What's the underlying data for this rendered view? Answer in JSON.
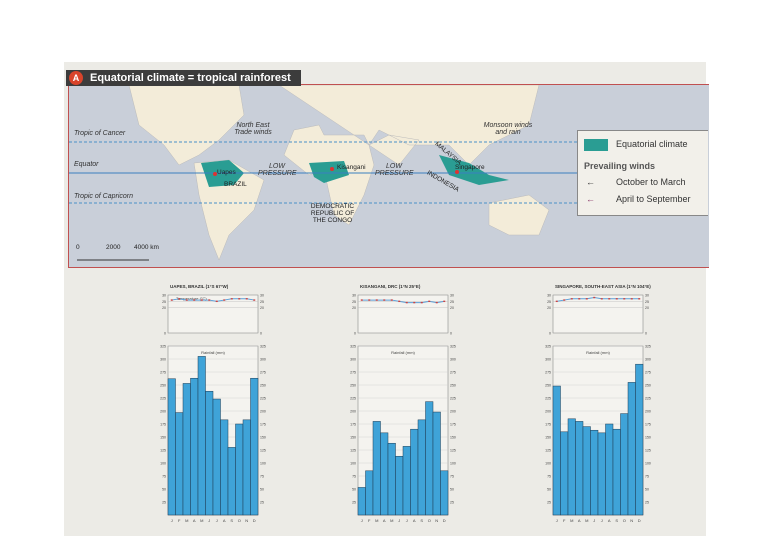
{
  "map": {
    "badge": "A",
    "title": "Equatorial climate = tropical rainforest",
    "lines": {
      "cancer": "Tropic of Cancer",
      "equator": "Equator",
      "capricorn": "Tropic of Capricorn"
    },
    "labels": {
      "ne_trade": "North East Trade winds",
      "monsoon": "Monsoon winds and rain",
      "low1": "LOW PRESSURE",
      "low2": "LOW PRESSURE",
      "uapes": "Uapes",
      "brazil": "BRAZIL",
      "kisangani": "Kisangani",
      "drc": "DEMOCRATIC REPUBLIC OF THE CONGO",
      "malaysia": "MALAYSIA",
      "singapore": "Singapore",
      "indonesia": "INDONESIA"
    },
    "scale": [
      "0",
      "2000",
      "4000 km"
    ],
    "legend": {
      "equatorial": "Equatorial climate",
      "winds_title": "Prevailing winds",
      "oct_mar": "October to March",
      "apr_sep": "April to September"
    },
    "colors": {
      "equatorial": "#2a9d93",
      "oct_mar": "#333333",
      "apr_sep": "#8a3a6a",
      "ocean": "#c9cfd9",
      "land": "#f3ecd9"
    }
  },
  "chart_data": [
    {
      "type": "bar",
      "title": "UAPES, BRAZIL (1°S 67°W)",
      "categories": [
        "J",
        "F",
        "M",
        "A",
        "M",
        "J",
        "J",
        "A",
        "S",
        "O",
        "N",
        "D"
      ],
      "temp_label": "Temperature (°C)",
      "temp": [
        26,
        27,
        26,
        26,
        26,
        26,
        25,
        26,
        27,
        27,
        27,
        26
      ],
      "temp_ylim": [
        0,
        30
      ],
      "temp_ticks": [
        "30",
        "25",
        "20",
        "0"
      ],
      "rain_label": "Rainfall (mm)",
      "rain": [
        262,
        197,
        253,
        263,
        305,
        238,
        223,
        183,
        130,
        175,
        183,
        263
      ],
      "rain_ylim": [
        0,
        325
      ],
      "rain_ticks": [
        "325",
        "300",
        "275",
        "250",
        "225",
        "200",
        "175",
        "150",
        "125",
        "100",
        "75",
        "50",
        "25"
      ]
    },
    {
      "type": "bar",
      "title": "KISANGANI, DRC (1°N 25°E)",
      "categories": [
        "J",
        "F",
        "M",
        "A",
        "M",
        "J",
        "J",
        "A",
        "S",
        "O",
        "N",
        "D"
      ],
      "temp_label": "",
      "temp": [
        26,
        26,
        26,
        26,
        26,
        25,
        24,
        24,
        24,
        25,
        24,
        25
      ],
      "temp_ylim": [
        0,
        30
      ],
      "temp_ticks": [
        "30",
        "25",
        "20",
        "0"
      ],
      "rain_label": "Rainfall (mm)",
      "rain": [
        53,
        85,
        180,
        158,
        138,
        113,
        132,
        165,
        183,
        218,
        198,
        85
      ],
      "rain_ylim": [
        0,
        325
      ],
      "rain_ticks": [
        "325",
        "300",
        "275",
        "250",
        "225",
        "200",
        "175",
        "150",
        "125",
        "100",
        "75",
        "50",
        "25"
      ]
    },
    {
      "type": "bar",
      "title": "SINGAPORE, SOUTH-EAST ASIA (1°N 104°E)",
      "categories": [
        "J",
        "F",
        "M",
        "A",
        "M",
        "J",
        "J",
        "A",
        "S",
        "O",
        "N",
        "D"
      ],
      "temp_label": "",
      "temp": [
        25,
        26,
        27,
        27,
        27,
        28,
        27,
        27,
        27,
        27,
        27,
        27
      ],
      "temp_ylim": [
        0,
        30
      ],
      "temp_ticks": [
        "30",
        "25",
        "20",
        "0"
      ],
      "rain_label": "Rainfall (mm)",
      "rain": [
        248,
        160,
        185,
        180,
        170,
        163,
        158,
        175,
        165,
        195,
        255,
        290
      ],
      "rain_ylim": [
        0,
        325
      ],
      "rain_ticks": [
        "325",
        "300",
        "275",
        "250",
        "225",
        "200",
        "175",
        "150",
        "125",
        "100",
        "75",
        "50",
        "25"
      ]
    }
  ]
}
